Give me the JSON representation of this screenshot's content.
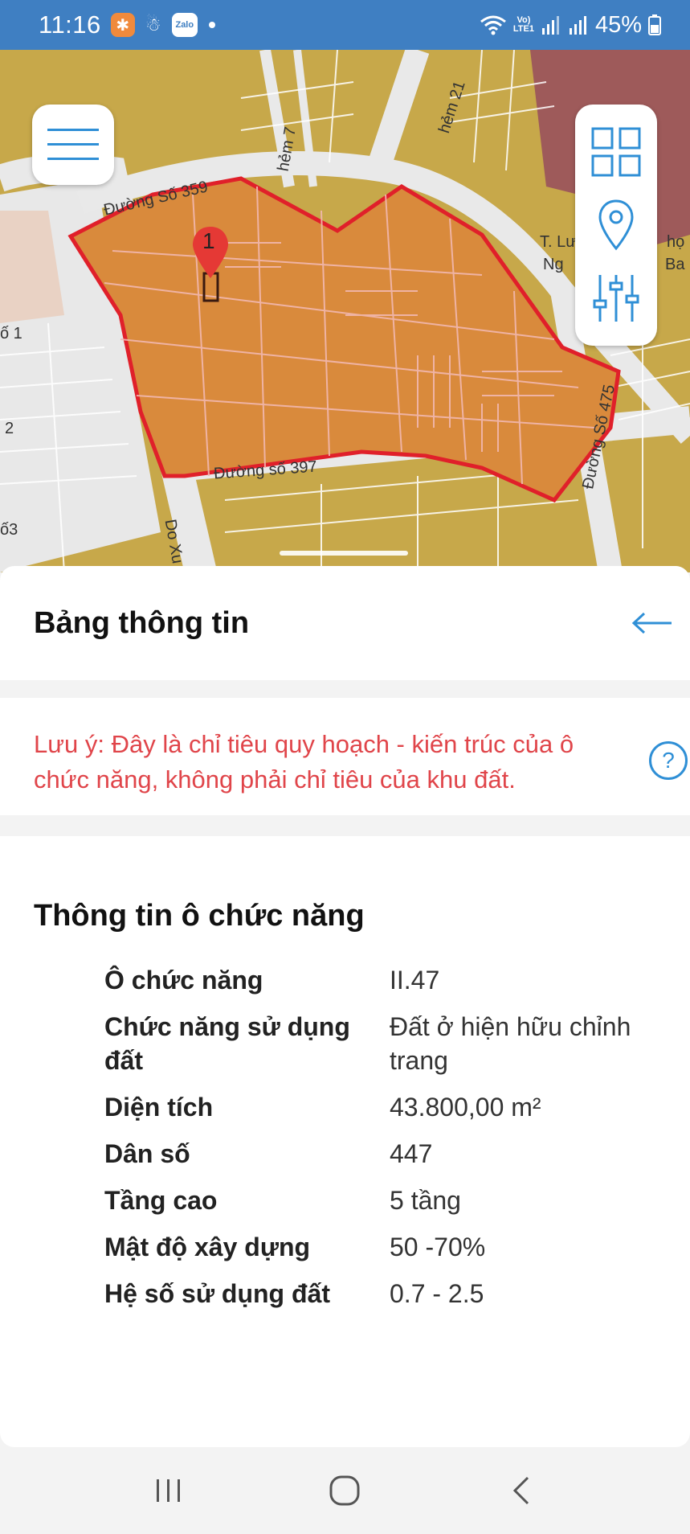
{
  "status_bar": {
    "time": "11:16",
    "battery": "45%",
    "network_label_top": "Vo)",
    "network_label_bottom": "LTE1",
    "zalo_label": "Zalo"
  },
  "map": {
    "road_labels": [
      "Đường Số 359",
      "Đường số 397",
      "Do Xu",
      "hẻm 21",
      "Đường Số 475",
      "T. Lươ",
      "họ",
      "Ng",
      "Ba",
      "ố 1",
      "2",
      "ố3",
      "hẻm 7"
    ],
    "marker_label": "1",
    "icons": {
      "menu": "hamburger-menu-icon",
      "grid": "grid-view-icon",
      "location": "location-pin-icon",
      "filters": "sliders-icon"
    },
    "colors": {
      "land": "#c7a84a",
      "zone_fill": "#d98a3c",
      "zone_border": "#e0202a",
      "roads": "#e9e9e9"
    }
  },
  "sheet": {
    "title": "Bảng thông tin",
    "back_icon": "arrow-left-icon"
  },
  "notice": {
    "text": "Lưu ý: Đây là chỉ tiêu quy hoạch - kiến trúc của ô chức năng, không phải chỉ tiêu của khu đất.",
    "help_label": "?"
  },
  "info": {
    "title": "Thông tin ô chức năng",
    "rows": [
      {
        "label": "Ô chức năng",
        "value": "II.47"
      },
      {
        "label": "Chức năng sử dụng đất",
        "value": "Đất ở hiện hữu chỉnh trang"
      },
      {
        "label": "Diện tích",
        "value": "43.800,00 m²"
      },
      {
        "label": "Dân số",
        "value": "447"
      },
      {
        "label": "Tầng cao",
        "value": "5 tầng"
      },
      {
        "label": "Mật độ xây dựng",
        "value": "50 -70%"
      },
      {
        "label": "Hệ số sử dụng đất",
        "value": "0.7 - 2.5"
      }
    ]
  },
  "nav_bar": {
    "recent": "recent-apps-icon",
    "home": "home-icon",
    "back": "back-icon"
  }
}
